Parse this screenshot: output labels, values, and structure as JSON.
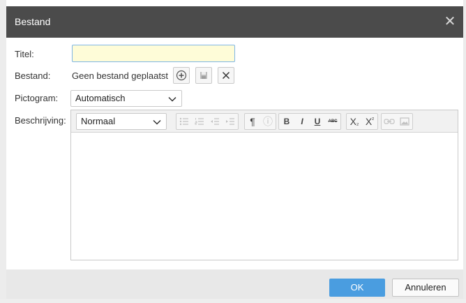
{
  "dialog": {
    "title": "Bestand",
    "close_icon": "close-icon"
  },
  "form": {
    "titel_label": "Titel:",
    "titel_value": "",
    "bestand_label": "Bestand:",
    "bestand_text": "Geen bestand geplaatst",
    "bestand_icons": [
      "upload-icon",
      "save-icon",
      "remove-icon"
    ],
    "pictogram_label": "Pictogram:",
    "pictogram_value": "Automatisch",
    "beschrijving_label": "Beschrijving:"
  },
  "editor": {
    "format_value": "Normaal",
    "toolbar": {
      "list_buttons": [
        "bulleted-list-icon",
        "numbered-list-icon",
        "outdent-icon",
        "indent-icon"
      ],
      "paragraph_icon": "¶",
      "info_icon": "ⓘ",
      "bold": "B",
      "italic": "I",
      "underline": "U",
      "strikethrough": "ABC",
      "subscript_base": "X",
      "subscript": "₂",
      "superscript_base": "X",
      "superscript": "²",
      "link_icon": "link-icon",
      "image_icon": "image-icon"
    },
    "content": ""
  },
  "footer": {
    "ok_label": "OK",
    "cancel_label": "Annuleren"
  },
  "colors": {
    "titlebar": "#4b4b4b",
    "input_highlight": "#fefcd8",
    "primary_button": "#4a9de0"
  }
}
